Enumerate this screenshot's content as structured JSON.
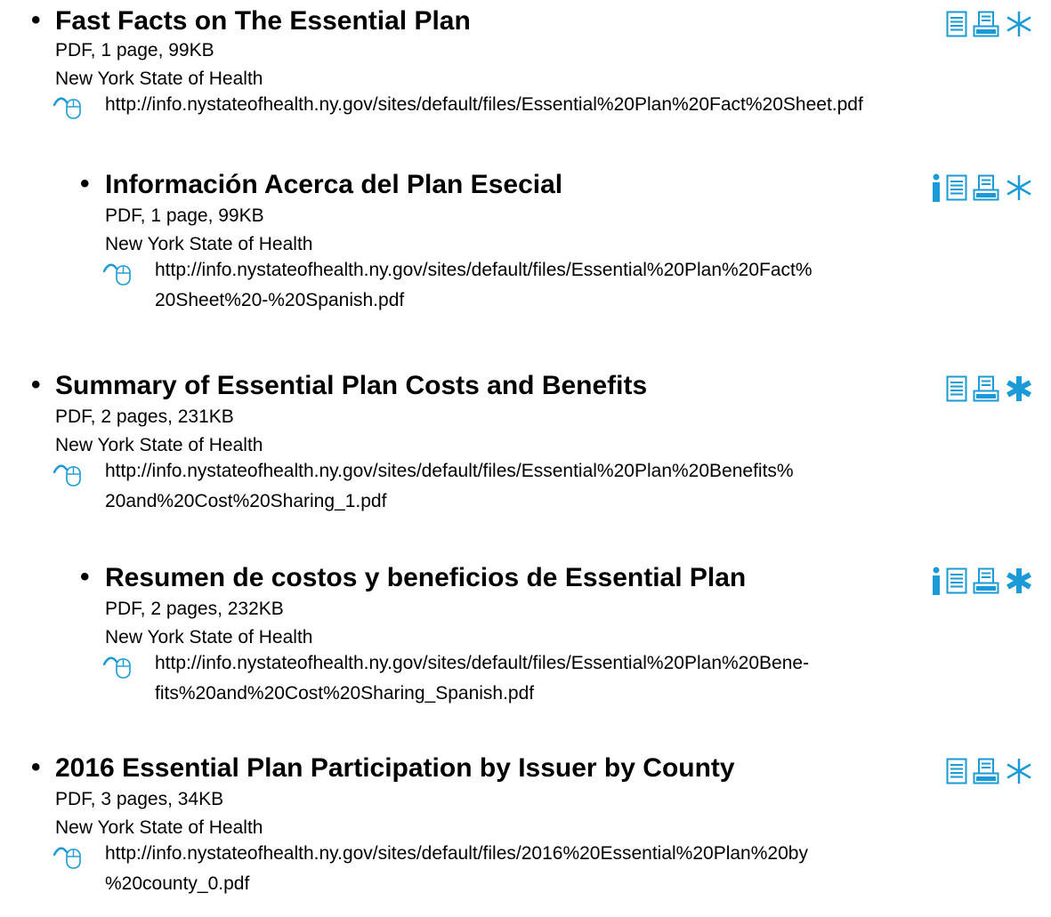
{
  "resources": [
    {
      "title": "Fast Facts on The Essential Plan",
      "meta": "PDF, 1 page, 99KB",
      "publisher": "New York State of Health",
      "url_lines": [
        "http://info.nystateofhealth.ny.gov/sites/default/files/Essential%20Plan%20Fact%20Sheet.pdf"
      ],
      "icons": [
        "document-icon",
        "printer-icon",
        "asterisk-icon"
      ]
    },
    {
      "title": "Información Acerca del Plan Esecial",
      "meta": "PDF, 1 page, 99KB",
      "publisher": "New York State of Health",
      "url_lines": [
        "http://info.nystateofhealth.ny.gov/sites/default/files/Essential%20Plan%20Fact%",
        "20Sheet%20-%20Spanish.pdf"
      ],
      "icons": [
        "info-icon",
        "document-icon",
        "printer-icon",
        "asterisk-icon"
      ]
    },
    {
      "title": "Summary of Essential Plan Costs and Benefits",
      "meta": "PDF, 2 pages, 231KB",
      "publisher": "New York State of Health",
      "url_lines": [
        "http://info.nystateofhealth.ny.gov/sites/default/files/Essential%20Plan%20Benefits%",
        "20and%20Cost%20Sharing_1.pdf"
      ],
      "icons": [
        "document-icon",
        "printer-icon",
        "asterisk-bold-icon"
      ]
    },
    {
      "title": "Resumen de costos y beneficios de Essential Plan",
      "meta": "PDF, 2 pages, 232KB",
      "publisher": "New York State of Health",
      "url_lines": [
        "http://info.nystateofhealth.ny.gov/sites/default/files/Essential%20Plan%20Bene-",
        "fits%20and%20Cost%20Sharing_Spanish.pdf"
      ],
      "icons": [
        "info-icon",
        "document-icon",
        "printer-icon",
        "asterisk-bold-icon"
      ]
    },
    {
      "title": "2016 Essential Plan Participation by Issuer by County",
      "meta": "PDF, 3 pages, 34KB",
      "publisher": "New York State of Health",
      "url_lines": [
        "http://info.nystateofhealth.ny.gov/sites/default/files/2016%20Essential%20Plan%20by",
        "%20county_0.pdf"
      ],
      "icons": [
        "document-icon",
        "printer-icon",
        "asterisk-icon"
      ]
    }
  ],
  "colors": {
    "accent": "#1a9ad6",
    "text": "#000000"
  }
}
